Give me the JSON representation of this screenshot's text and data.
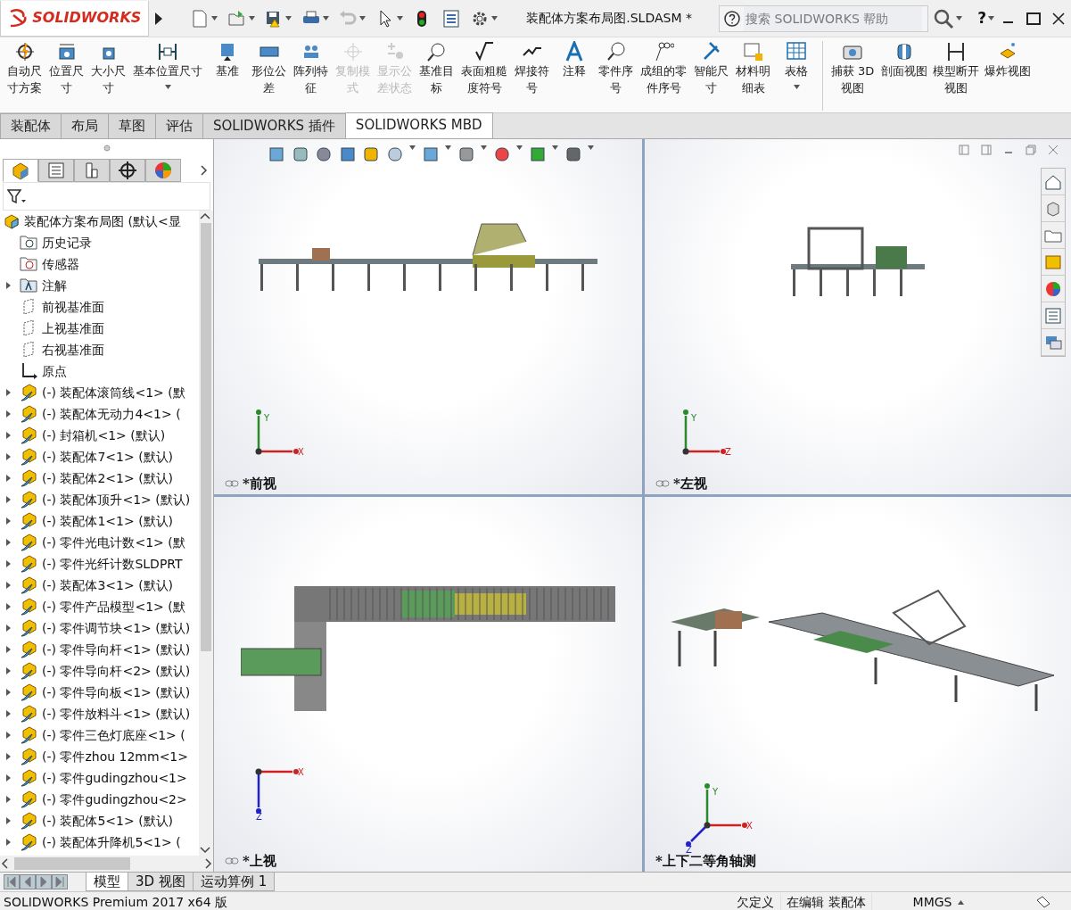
{
  "app": {
    "logo": "SOLIDWORKS",
    "title": "装配体方案布局图.SLDASM *",
    "search": {
      "placeholder": "搜索 SOLIDWORKS 帮助"
    },
    "help": "?"
  },
  "ribbon": {
    "groups": [
      {
        "items": [
          {
            "label": "自动尺寸方案",
            "disabled": false,
            "dropdown": false
          },
          {
            "label": "位置尺寸",
            "disabled": false,
            "dropdown": false
          },
          {
            "label": "大小尺寸",
            "disabled": false,
            "dropdown": false
          },
          {
            "label": "基本位置尺寸",
            "disabled": false,
            "dropdown": true
          },
          {
            "label": "基准",
            "disabled": false,
            "dropdown": false
          },
          {
            "label": "形位公差",
            "disabled": false,
            "dropdown": false
          },
          {
            "label": "阵列特征",
            "disabled": false,
            "dropdown": false
          },
          {
            "label": "复制模式",
            "disabled": true,
            "dropdown": false
          },
          {
            "label": "显示公差状态",
            "disabled": true,
            "dropdown": false
          },
          {
            "label": "基准目标",
            "disabled": false,
            "dropdown": false
          },
          {
            "label": "表面粗糙度符号",
            "disabled": false,
            "dropdown": false
          },
          {
            "label": "焊接符号",
            "disabled": false,
            "dropdown": false
          },
          {
            "label": "注释",
            "disabled": false,
            "dropdown": false
          },
          {
            "label": "零件序号",
            "disabled": false,
            "dropdown": false
          },
          {
            "label": "成组的零件序号",
            "disabled": false,
            "dropdown": false
          },
          {
            "label": "智能尺寸",
            "disabled": false,
            "dropdown": false
          },
          {
            "label": "材料明细表",
            "disabled": false,
            "dropdown": false
          },
          {
            "label": "表格",
            "disabled": false,
            "dropdown": true
          }
        ]
      },
      {
        "items": [
          {
            "label": "捕获 3D 视图",
            "disabled": false,
            "dropdown": false
          },
          {
            "label": "剖面视图",
            "disabled": false,
            "dropdown": false
          },
          {
            "label": "模型断开视图",
            "disabled": false,
            "dropdown": false
          },
          {
            "label": "爆炸视图",
            "disabled": false,
            "dropdown": false
          }
        ]
      }
    ]
  },
  "tabs": [
    {
      "label": "装配体",
      "selected": false
    },
    {
      "label": "布局",
      "selected": false
    },
    {
      "label": "草图",
      "selected": false
    },
    {
      "label": "评估",
      "selected": false
    },
    {
      "label": "SOLIDWORKS 插件",
      "selected": false
    },
    {
      "label": "SOLIDWORKS MBD",
      "selected": true
    }
  ],
  "tree": {
    "root": "装配体方案布局图  (默认<显",
    "items": [
      {
        "label": "历史记录",
        "kind": "history",
        "expandable": false
      },
      {
        "label": "传感器",
        "kind": "sensor",
        "expandable": false
      },
      {
        "label": "注解",
        "kind": "annotation",
        "expandable": true
      },
      {
        "label": "前视基准面",
        "kind": "plane",
        "expandable": false
      },
      {
        "label": "上视基准面",
        "kind": "plane",
        "expandable": false
      },
      {
        "label": "右视基准面",
        "kind": "plane",
        "expandable": false
      },
      {
        "label": "原点",
        "kind": "origin",
        "expandable": false
      },
      {
        "label": "(-) 装配体滚筒线<1> (默",
        "kind": "component",
        "expandable": true
      },
      {
        "label": "(-) 装配体无动力4<1> (",
        "kind": "component",
        "expandable": true
      },
      {
        "label": "(-) 封箱机<1> (默认)",
        "kind": "component",
        "expandable": true
      },
      {
        "label": "(-) 装配体7<1> (默认)",
        "kind": "component",
        "expandable": true
      },
      {
        "label": "(-) 装配体2<1> (默认)",
        "kind": "component",
        "expandable": true
      },
      {
        "label": "(-) 装配体顶升<1> (默认)",
        "kind": "component",
        "expandable": true
      },
      {
        "label": "(-) 装配体1<1> (默认)",
        "kind": "component",
        "expandable": true
      },
      {
        "label": "(-) 零件光电计数<1> (默",
        "kind": "component",
        "expandable": true
      },
      {
        "label": "(-) 零件光纤计数SLDPRT",
        "kind": "component",
        "expandable": true
      },
      {
        "label": "(-) 装配体3<1> (默认)",
        "kind": "component",
        "expandable": true
      },
      {
        "label": "(-) 零件产品模型<1> (默",
        "kind": "component",
        "expandable": true
      },
      {
        "label": "(-) 零件调节块<1> (默认)",
        "kind": "component",
        "expandable": true
      },
      {
        "label": "(-) 零件导向杆<1> (默认)",
        "kind": "component",
        "expandable": true
      },
      {
        "label": "(-) 零件导向杆<2> (默认)",
        "kind": "component",
        "expandable": true
      },
      {
        "label": "(-) 零件导向板<1> (默认)",
        "kind": "component",
        "expandable": true
      },
      {
        "label": "(-) 零件放料斗<1> (默认)",
        "kind": "component",
        "expandable": true
      },
      {
        "label": "(-) 零件三色灯底座<1> (",
        "kind": "component",
        "expandable": true
      },
      {
        "label": "(-) 零件zhou  12mm<1>",
        "kind": "component",
        "expandable": true
      },
      {
        "label": "(-) 零件gudingzhou<1>",
        "kind": "component",
        "expandable": true
      },
      {
        "label": "(-) 零件gudingzhou<2>",
        "kind": "component",
        "expandable": true
      },
      {
        "label": "(-) 装配体5<1> (默认)",
        "kind": "component",
        "expandable": true
      },
      {
        "label": "(-) 装配体升降机5<1> (",
        "kind": "component",
        "expandable": true
      }
    ]
  },
  "viewports": [
    {
      "label": "*前视",
      "kind": "front",
      "triad": [
        "Y",
        "X"
      ]
    },
    {
      "label": "*左视",
      "kind": "left",
      "triad": [
        "Y",
        "Z"
      ]
    },
    {
      "label": "*上视",
      "kind": "top",
      "triad": [
        "X",
        "Z"
      ]
    },
    {
      "label": "*上下二等角轴测",
      "kind": "iso",
      "triad": [
        "Y",
        "X",
        "Z"
      ]
    }
  ],
  "bottom_tabs": [
    {
      "label": "模型",
      "selected": true
    },
    {
      "label": "3D 视图",
      "selected": false
    },
    {
      "label": "运动算例 1",
      "selected": false
    }
  ],
  "status_bar": {
    "product": "SOLIDWORKS Premium 2017 x64 版",
    "state": "欠定义",
    "mode": "在编辑 装配体",
    "units": "MMGS"
  }
}
